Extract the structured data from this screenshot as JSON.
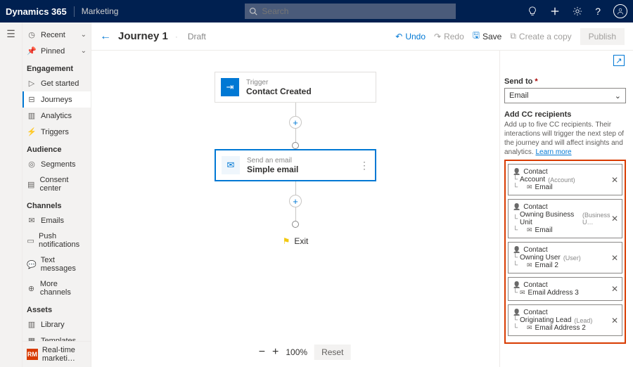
{
  "topbar": {
    "brand": "Dynamics 365",
    "app": "Marketing",
    "search_placeholder": "Search"
  },
  "header": {
    "title": "Journey 1",
    "status": "Draft",
    "undo": "Undo",
    "redo": "Redo",
    "save": "Save",
    "copy": "Create a copy",
    "publish": "Publish"
  },
  "sidebar": {
    "recent": "Recent",
    "pinned": "Pinned",
    "groups": [
      {
        "title": "Engagement",
        "items": [
          "Get started",
          "Journeys",
          "Analytics",
          "Triggers"
        ]
      },
      {
        "title": "Audience",
        "items": [
          "Segments",
          "Consent center"
        ]
      },
      {
        "title": "Channels",
        "items": [
          "Emails",
          "Push notifications",
          "Text messages",
          "More channels"
        ]
      },
      {
        "title": "Assets",
        "items": [
          "Library",
          "Templates"
        ]
      }
    ],
    "footer_badge": "RM",
    "footer_label": "Real-time marketi…"
  },
  "flow": {
    "trigger_label": "Trigger",
    "trigger_title": "Contact Created",
    "email_label": "Send an email",
    "email_title": "Simple email",
    "exit": "Exit"
  },
  "zoom": {
    "level": "100%",
    "reset": "Reset"
  },
  "panel": {
    "send_to_label": "Send to",
    "send_to_value": "Email",
    "cc_title": "Add CC recipients",
    "cc_desc": "Add up to five CC recipients. Their interactions will trigger the next step of the journey and will affect insights and analytics. ",
    "learn_more": "Learn more",
    "cards": [
      {
        "l1": "Contact",
        "l2": "Account",
        "l2sub": "(Account)",
        "l3": "Email"
      },
      {
        "l1": "Contact",
        "l2": "Owning Business Unit",
        "l2sub": "(Business U…",
        "l3": "Email"
      },
      {
        "l1": "Contact",
        "l2": "Owning User",
        "l2sub": "(User)",
        "l3": "Email 2"
      },
      {
        "l1": "Contact",
        "l2": "",
        "l2sub": "",
        "l3": "Email Address 3"
      },
      {
        "l1": "Contact",
        "l2": "Originating Lead",
        "l2sub": "(Lead)",
        "l3": "Email Address 2"
      }
    ]
  }
}
